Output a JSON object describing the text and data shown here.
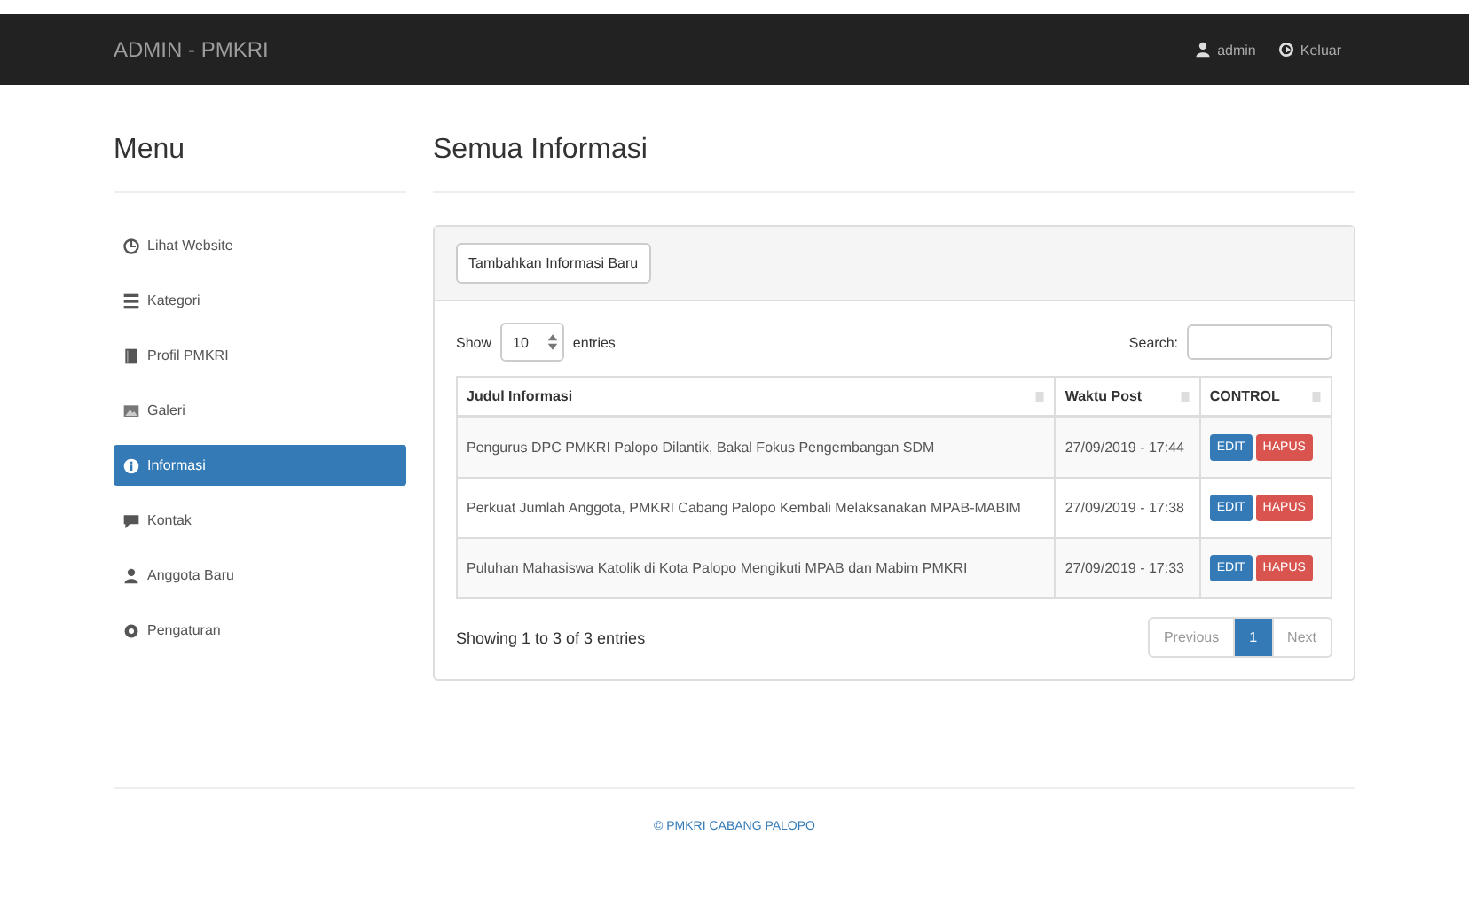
{
  "navbar": {
    "brand": "ADMIN - PMKRI",
    "links": [
      {
        "kind": "user",
        "label": "admin"
      },
      {
        "kind": "logout",
        "label": "Keluar"
      }
    ]
  },
  "sidebar": {
    "title": "Menu",
    "items": [
      {
        "label": "Lihat Website",
        "selected": false
      },
      {
        "label": "Kategori",
        "selected": false
      },
      {
        "label": "Profil PMKRI",
        "selected": false
      },
      {
        "label": "Galeri",
        "selected": false
      },
      {
        "label": "Informasi",
        "selected": true
      },
      {
        "label": "Kontak",
        "selected": false
      },
      {
        "label": "Anggota Baru",
        "selected": false
      },
      {
        "label": "Pengaturan",
        "selected": false
      }
    ]
  },
  "page_title": "Semua Informasi",
  "add_button": "Tambahkan Informasi Baru",
  "table_controls": {
    "show_label": "Show",
    "entries_value": "10",
    "entries_label": "entries",
    "search_label": "Search:"
  },
  "table": {
    "columns": [
      "Judul Informasi",
      "Waktu Post",
      "CONTROL"
    ],
    "rows": [
      {
        "title": "Pengurus DPC PMKRI Palopo Dilantik, Bakal Fokus Pengembangan SDM",
        "time": "27/09/2019 - 17:44",
        "edit": "EDIT",
        "delete": "HAPUS"
      },
      {
        "title": "Perkuat Jumlah Anggota, PMKRI Cabang Palopo Kembali Melaksanakan MPAB-MABIM",
        "time": "27/09/2019 - 17:38",
        "edit": "EDIT",
        "delete": "HAPUS"
      },
      {
        "title": "Puluhan Mahasiswa Katolik di Kota Palopo Mengikuti MPAB dan Mabim PMKRI",
        "time": "27/09/2019 - 17:33",
        "edit": "EDIT",
        "delete": "HAPUS"
      }
    ]
  },
  "table_info": "Showing 1 to 3 of 3 entries",
  "pagination": [
    {
      "kind": "prev",
      "label": "Previous",
      "selected": false
    },
    {
      "kind": "page",
      "label": "1",
      "selected": true
    },
    {
      "kind": "next",
      "label": "Next",
      "selected": false
    }
  ],
  "footer": "© PMKRI CABANG PALOPO"
}
